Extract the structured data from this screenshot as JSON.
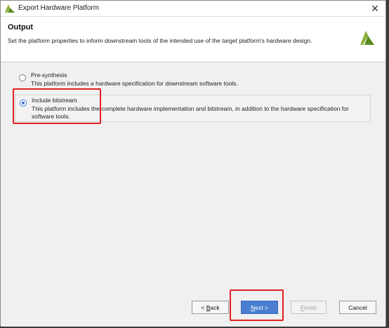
{
  "window": {
    "title": "Export Hardware Platform",
    "close_icon": "close-icon"
  },
  "header": {
    "title": "Output",
    "description": "Set the platform properties to inform downstream tools of the intended use of the target platform's hardware design."
  },
  "options": [
    {
      "label": "Pre-synthesis",
      "description": "This platform includes a hardware specification for downstream software tools.",
      "selected": false
    },
    {
      "label": "Include bitstream",
      "description": "This platform includes the complete hardware implementation and bitstream, in addition to the hardware specification for software tools.",
      "selected": true
    }
  ],
  "buttons": {
    "back": {
      "prefix": "< ",
      "mnemonic": "B",
      "rest": "ack"
    },
    "next": {
      "mnemonic": "N",
      "rest": "ext >"
    },
    "finish": {
      "mnemonic": "F",
      "rest": "inish"
    },
    "cancel": "Cancel"
  },
  "colors": {
    "accent": "#4a7fd0",
    "highlight": "#e32020",
    "logo": "#8cb13a"
  }
}
